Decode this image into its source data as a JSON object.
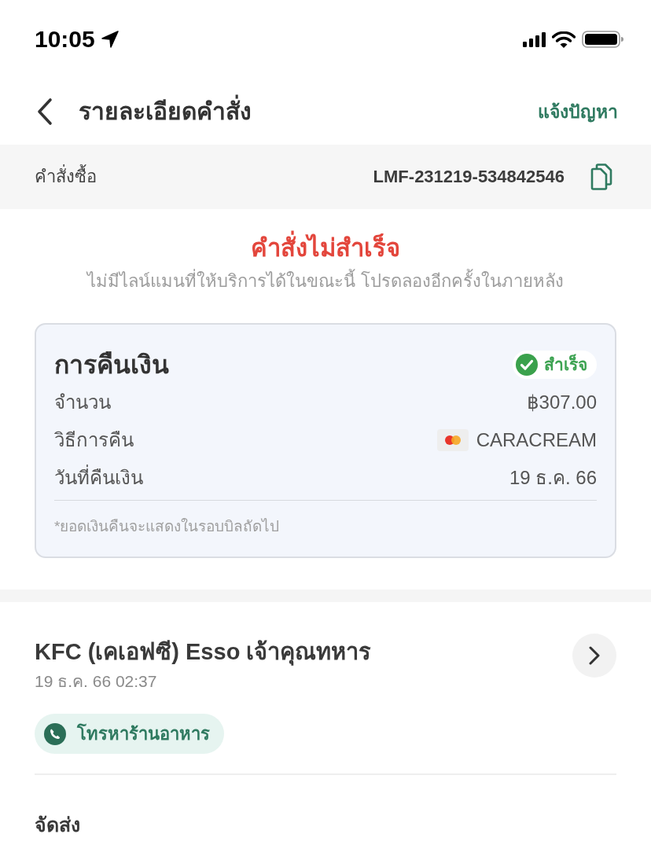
{
  "status_bar": {
    "time": "10:05"
  },
  "header": {
    "title": "รายละเอียดคำสั่ง",
    "action": "แจ้งปัญหา"
  },
  "order": {
    "label": "คำสั่งซื้อ",
    "number": "LMF-231219-534842546"
  },
  "order_status": {
    "title": "คำสั่งไม่สำเร็จ",
    "message": "ไม่มีไลน์แมนที่ให้บริการได้ในขณะนี้ โปรดลองอีกครั้งในภายหลัง"
  },
  "refund": {
    "title": "การคืนเงิน",
    "status": "สำเร็จ",
    "rows": [
      {
        "kind": "text",
        "label": "จำนวน",
        "value": "฿307.00"
      },
      {
        "kind": "card",
        "label": "วิธีการคืน",
        "value": "CARACREAM"
      },
      {
        "kind": "text",
        "label": "วันที่คืนเงิน",
        "value": "19 ธ.ค. 66"
      }
    ],
    "note": "*ยอดเงินคืนจะแสดงในรอบบิลถัดไป"
  },
  "restaurant": {
    "name": "KFC (เคเอฟซี) Esso เจ้าคุณทหาร",
    "time": "19 ธ.ค. 66 02:37",
    "call_button": "โทรหาร้านอาหาร"
  },
  "section": {
    "title": "จัดส่ง"
  }
}
